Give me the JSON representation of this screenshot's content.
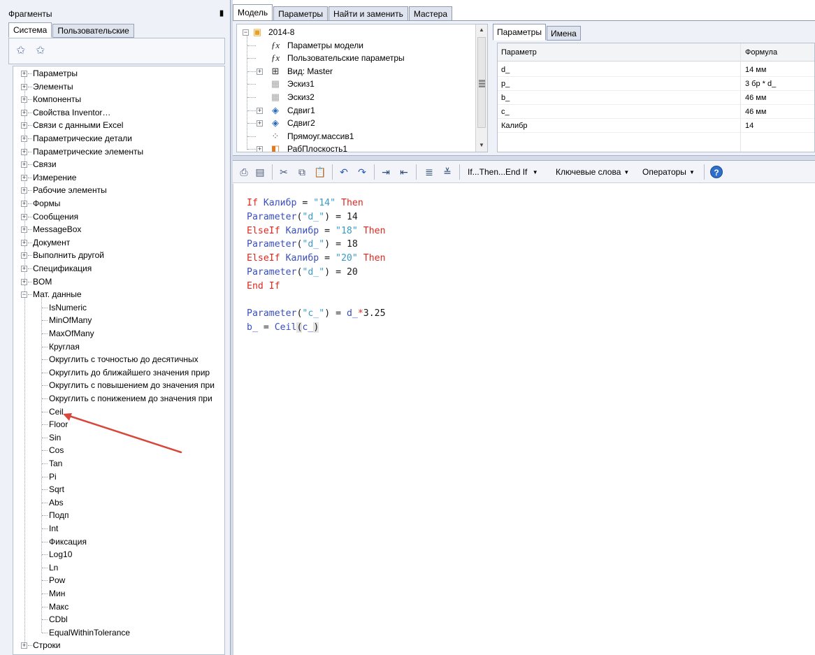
{
  "left_panel": {
    "title": "Фрагменты",
    "pin_icon": "pin-icon",
    "tabs": [
      {
        "label": "Система",
        "active": true
      },
      {
        "label": "Пользовательские",
        "active": false
      }
    ],
    "toolbar_icons": [
      "add-favorite-icon",
      "edit-favorite-icon"
    ],
    "tree": [
      {
        "label": "Параметры",
        "level": 0,
        "expander": "+"
      },
      {
        "label": "Элементы",
        "level": 0,
        "expander": "+"
      },
      {
        "label": "Компоненты",
        "level": 0,
        "expander": "+"
      },
      {
        "label": "Свойства Inventor…",
        "level": 0,
        "expander": "+"
      },
      {
        "label": "Связи с данными Excel",
        "level": 0,
        "expander": "+"
      },
      {
        "label": "Параметрические детали",
        "level": 0,
        "expander": "+"
      },
      {
        "label": "Параметрические элементы",
        "level": 0,
        "expander": "+"
      },
      {
        "label": "Связи",
        "level": 0,
        "expander": "+"
      },
      {
        "label": "Измерение",
        "level": 0,
        "expander": "+"
      },
      {
        "label": "Рабочие элементы",
        "level": 0,
        "expander": "+"
      },
      {
        "label": "Формы",
        "level": 0,
        "expander": "+"
      },
      {
        "label": "Сообщения",
        "level": 0,
        "expander": "+"
      },
      {
        "label": "MessageBox",
        "level": 0,
        "expander": "+"
      },
      {
        "label": "Документ",
        "level": 0,
        "expander": "+"
      },
      {
        "label": "Выполнить другой",
        "level": 0,
        "expander": "+"
      },
      {
        "label": "Спецификация",
        "level": 0,
        "expander": "+"
      },
      {
        "label": "BOM",
        "level": 0,
        "expander": "+"
      },
      {
        "label": "Мат. данные",
        "level": 0,
        "expander": "-"
      },
      {
        "label": "IsNumeric",
        "level": 1
      },
      {
        "label": "MinOfMany",
        "level": 1
      },
      {
        "label": "MaxOfMany",
        "level": 1
      },
      {
        "label": "Круглая",
        "level": 1
      },
      {
        "label": "Округлить с точностью до десятичных",
        "level": 1
      },
      {
        "label": "Округлить до ближайшего значения прир",
        "level": 1
      },
      {
        "label": "Округлить с повышением до значения при",
        "level": 1
      },
      {
        "label": "Округлить с понижением до значения при",
        "level": 1
      },
      {
        "label": "Ceil",
        "level": 1
      },
      {
        "label": "Floor",
        "level": 1
      },
      {
        "label": "Sin",
        "level": 1
      },
      {
        "label": "Cos",
        "level": 1
      },
      {
        "label": "Tan",
        "level": 1
      },
      {
        "label": "Pi",
        "level": 1
      },
      {
        "label": "Sqrt",
        "level": 1
      },
      {
        "label": "Abs",
        "level": 1
      },
      {
        "label": "Подп",
        "level": 1
      },
      {
        "label": "Int",
        "level": 1
      },
      {
        "label": "Фиксация",
        "level": 1
      },
      {
        "label": "Log10",
        "level": 1
      },
      {
        "label": "Ln",
        "level": 1
      },
      {
        "label": "Pow",
        "level": 1
      },
      {
        "label": "Мин",
        "level": 1
      },
      {
        "label": "Макс",
        "level": 1
      },
      {
        "label": "CDbl",
        "level": 1
      },
      {
        "label": "EqualWithinTolerance",
        "level": 1
      },
      {
        "label": "Строки",
        "level": 0,
        "expander": "+"
      }
    ]
  },
  "main_tabs": [
    {
      "label": "Модель",
      "active": true
    },
    {
      "label": "Параметры",
      "active": false
    },
    {
      "label": "Найти и заменить",
      "active": false
    },
    {
      "label": "Мастера",
      "active": false
    }
  ],
  "model_tree": [
    {
      "label": "2014-8",
      "icon": "part-cube-icon",
      "glyph": "▣",
      "color": "#e8a020",
      "expander": "-",
      "level": 0
    },
    {
      "label": "Параметры модели",
      "icon": "fx-icon",
      "glyph": "ƒx",
      "color": "#222",
      "expander": "",
      "level": 1
    },
    {
      "label": "Пользовательские параметры",
      "icon": "fx-icon",
      "glyph": "ƒx",
      "color": "#222",
      "expander": "",
      "level": 1
    },
    {
      "label": "Вид: Master",
      "icon": "view-rep-icon",
      "glyph": "⊞",
      "color": "#333",
      "expander": "+",
      "level": 1
    },
    {
      "label": "Эскиз1",
      "icon": "sketch-icon",
      "glyph": "▦",
      "color": "#aaa",
      "expander": "",
      "level": 1
    },
    {
      "label": "Эскиз2",
      "icon": "sketch-icon",
      "glyph": "▦",
      "color": "#aaa",
      "expander": "",
      "level": 1
    },
    {
      "label": "Сдвиг1",
      "icon": "extrude-icon",
      "glyph": "◈",
      "color": "#2a6ab8",
      "expander": "+",
      "level": 1
    },
    {
      "label": "Сдвиг2",
      "icon": "extrude-icon",
      "glyph": "◈",
      "color": "#2a6ab8",
      "expander": "+",
      "level": 1
    },
    {
      "label": "Прямоуг.массив1",
      "icon": "pattern-icon",
      "glyph": "⁘",
      "color": "#555",
      "expander": "",
      "level": 1
    },
    {
      "label": "РабПлоскость1",
      "icon": "work-plane-icon",
      "glyph": "◧",
      "color": "#e07a20",
      "expander": "+",
      "level": 1
    }
  ],
  "params_pane": {
    "tabs": [
      {
        "label": "Параметры",
        "active": true
      },
      {
        "label": "Имена",
        "active": false
      }
    ],
    "columns": [
      "Параметр",
      "Формула"
    ],
    "rows": [
      [
        "d_",
        "14 мм"
      ],
      [
        "p_",
        "3 бр * d_"
      ],
      [
        "b_",
        "46 мм"
      ],
      [
        "c_",
        "46 мм"
      ],
      [
        "Калибр",
        "14"
      ]
    ]
  },
  "editor_toolbar": {
    "icons": [
      "print-icon",
      "copy-doc-icon",
      "cut-icon",
      "copy-icon",
      "paste-icon",
      "undo-icon",
      "redo-icon",
      "indent-icon",
      "outdent-icon",
      "comment-icon",
      "uncomment-icon"
    ],
    "if_then": "If...Then...End If",
    "keywords_label": "Ключевые слова",
    "operators_label": "Операторы",
    "help_glyph": "?"
  },
  "code": [
    [
      {
        "t": "If ",
        "c": "kw"
      },
      {
        "t": "Калибр",
        "c": "fn"
      },
      {
        "t": " = ",
        "c": "pl"
      },
      {
        "t": "\"14\"",
        "c": "str"
      },
      {
        "t": " Then",
        "c": "kw"
      }
    ],
    [
      {
        "t": "Parameter",
        "c": "fn"
      },
      {
        "t": "(",
        "c": "pl"
      },
      {
        "t": "\"d_\"",
        "c": "str"
      },
      {
        "t": ") = 14",
        "c": "pl"
      }
    ],
    [
      {
        "t": "ElseIf ",
        "c": "kw"
      },
      {
        "t": "Калибр",
        "c": "fn"
      },
      {
        "t": " = ",
        "c": "pl"
      },
      {
        "t": "\"18\"",
        "c": "str"
      },
      {
        "t": " Then",
        "c": "kw"
      }
    ],
    [
      {
        "t": "Parameter",
        "c": "fn"
      },
      {
        "t": "(",
        "c": "pl"
      },
      {
        "t": "\"d_\"",
        "c": "str"
      },
      {
        "t": ") = 18",
        "c": "pl"
      }
    ],
    [
      {
        "t": "ElseIf ",
        "c": "kw"
      },
      {
        "t": "Калибр",
        "c": "fn"
      },
      {
        "t": " = ",
        "c": "pl"
      },
      {
        "t": "\"20\"",
        "c": "str"
      },
      {
        "t": " Then",
        "c": "kw"
      }
    ],
    [
      {
        "t": "Parameter",
        "c": "fn"
      },
      {
        "t": "(",
        "c": "pl"
      },
      {
        "t": "\"d_\"",
        "c": "str"
      },
      {
        "t": ") = 20",
        "c": "pl"
      }
    ],
    [
      {
        "t": "End If",
        "c": "kw"
      }
    ],
    [],
    [
      {
        "t": "Parameter",
        "c": "fn"
      },
      {
        "t": "(",
        "c": "pl"
      },
      {
        "t": "\"c_\"",
        "c": "str"
      },
      {
        "t": ") = ",
        "c": "pl"
      },
      {
        "t": "d_",
        "c": "fn"
      },
      {
        "t": "*",
        "c": "kw"
      },
      {
        "t": "3.25",
        "c": "pl"
      }
    ],
    [
      {
        "t": "b_",
        "c": "fn"
      },
      {
        "t": " = ",
        "c": "pl"
      },
      {
        "t": "Ceil",
        "c": "fn"
      },
      {
        "t": "(",
        "c": "pl hl"
      },
      {
        "t": "c_",
        "c": "fn"
      },
      {
        "t": ")",
        "c": "pl hl"
      }
    ]
  ],
  "annotation": {
    "color": "#d9463a"
  }
}
